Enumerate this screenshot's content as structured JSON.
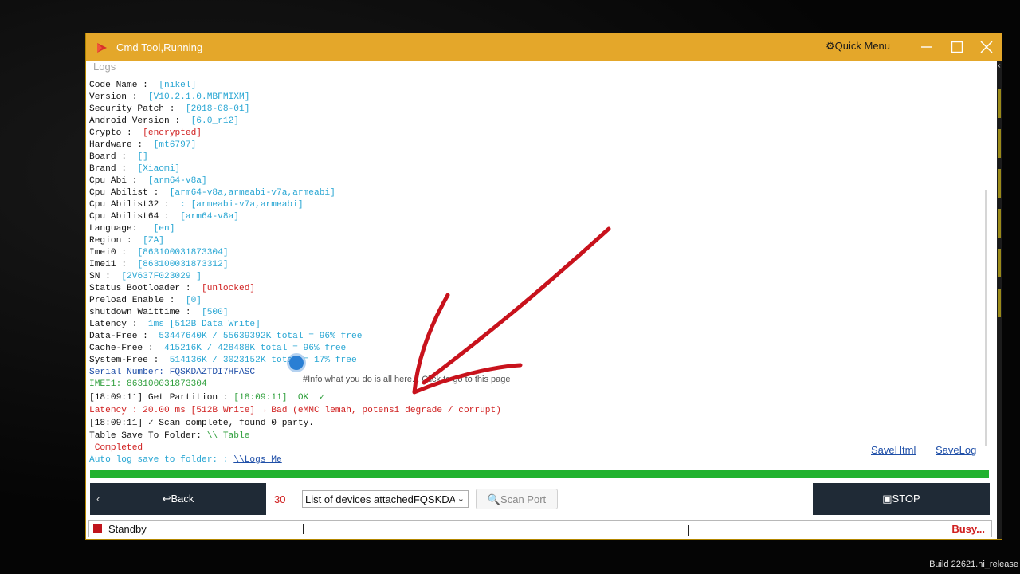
{
  "window": {
    "title": "Cmd Tool,Running",
    "quick_menu": "⚙Quick Menu",
    "logs_label": "Logs"
  },
  "log": {
    "code_name": {
      "key": "Code Name : ",
      "val": "[nikel]"
    },
    "version": {
      "key": "Version : ",
      "val": "[V10.2.1.0.MBFMIXM]"
    },
    "security_patch": {
      "key": "Security Patch : ",
      "val": "[2018-08-01]"
    },
    "android_version": {
      "key": "Android Version : ",
      "val": "[6.0_r12]"
    },
    "crypto": {
      "key": "Crypto : ",
      "val": "[encrypted]"
    },
    "hardware": {
      "key": "Hardware : ",
      "val": "[mt6797]"
    },
    "board": {
      "key": "Board : ",
      "val": "[]"
    },
    "brand": {
      "key": "Brand : ",
      "val": "[Xiaomi]"
    },
    "cpu_abi": {
      "key": "Cpu Abi : ",
      "val": "[arm64-v8a]"
    },
    "cpu_abilist": {
      "key": "Cpu Abilist : ",
      "val": "[arm64-v8a,armeabi-v7a,armeabi]"
    },
    "cpu_abilist32": {
      "key": "Cpu Abilist32 : ",
      "val": ": [armeabi-v7a,armeabi]"
    },
    "cpu_abilist64": {
      "key": "Cpu Abilist64 : ",
      "val": "[arm64-v8a]"
    },
    "language": {
      "key": "Language: ",
      "val": "[en]"
    },
    "region": {
      "key": "Region : ",
      "val": "[ZA]"
    },
    "imei0": {
      "key": "Imei0 : ",
      "val": "[863100031873304]"
    },
    "imei1": {
      "key": "Imei1 : ",
      "val": "[863100031873312]"
    },
    "sn": {
      "key": "SN : ",
      "val": "[2V637F023029 ]"
    },
    "status_bootloader": {
      "key": "Status Bootloader : ",
      "val": "[unlocked]"
    },
    "preload_enable": {
      "key": "Preload Enable : ",
      "val": "[0]"
    },
    "shutdown_waittime": {
      "key": "shutdown Waittime : ",
      "val": "[500]"
    },
    "latency": {
      "key": "Latency : ",
      "val": "1ms [512B Data Write]"
    },
    "data_free": {
      "key": "Data-Free : ",
      "val": "53447640K / 55639392K total = 96% free"
    },
    "cache_free": {
      "key": "Cache-Free : ",
      "val": "415216K / 428488K total = 96% free"
    },
    "system_free": {
      "key": "System-Free : ",
      "val": "514136K / 3023152K total = 17% free"
    },
    "serial_number": "Serial Number: FQSKDAZTDI7HFASC",
    "imei1_line": "IMEI1: 863100031873304",
    "get_partition": {
      "key": "[18:09:11] Get Partition : ",
      "val": "[18:09:11]  OK  ✓"
    },
    "latency_bad": "Latency : 20.00 ms [512B Write] → Bad (eMMC lemah, potensi degrade / corrupt)",
    "scan_complete": "[18:09:11] ✓ Scan complete, found 0 party.",
    "table_save": {
      "key": "Table Save To Folder: ",
      "val": "\\\\ Table"
    },
    "completed": " Completed",
    "auto_log": {
      "key": "Auto log save to folder: : ",
      "val": "\\\\Logs_Me"
    }
  },
  "tooltip": "#Info what you do is all here... Click to go to this page",
  "links": {
    "save_html": "SaveHtml",
    "save_log": "SaveLog"
  },
  "progress": {
    "percent": 100,
    "color": "#22b22f"
  },
  "toolbar": {
    "back_chevron": "‹",
    "back_label": "↩Back",
    "device_count": "30",
    "device_select": "List of devices attachedFQSKDAZTDI7HFASC",
    "scan_port_label": "🔍Scan Port",
    "stop_label": "▣STOP"
  },
  "status": {
    "text": "Standby",
    "busy": "Busy..."
  },
  "taskbar": {
    "build": "Build 22621.ni_release"
  },
  "colors": {
    "titlebar": "#e4a72a",
    "dark_button": "#1f2a36",
    "accent_blue": "#28a6d3",
    "error_red": "#d02020"
  }
}
